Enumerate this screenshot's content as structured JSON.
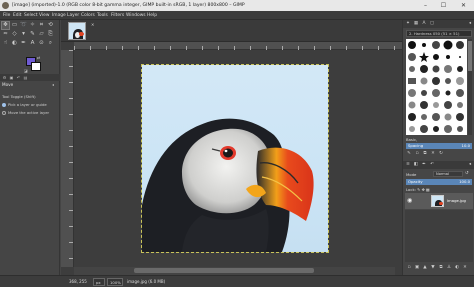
{
  "window": {
    "title": "[image] (imported)-1.0 (RGB color 8-bit gamma integer, GIMP built-in sRGB, 1 layer) 800x800 – GIMP",
    "minimize": "–",
    "maximize": "☐",
    "close": "✕"
  },
  "menu": [
    "File",
    "Edit",
    "Select",
    "View",
    "Image",
    "Layer",
    "Colors",
    "Tools",
    "Filters",
    "Windows",
    "Help"
  ],
  "colors": {
    "foreground": "#6f5bd4",
    "background": "#ffffff",
    "accent": "#5a86b8"
  },
  "tool_options": {
    "title": "Move",
    "tool_toggle_label": "Tool Toggle (Shift)",
    "option_pick": "Pick a layer or guide",
    "option_move_active": "Move the active layer"
  },
  "image_tab": {
    "close": "✕"
  },
  "brushes": {
    "filter_text": "2. Hardness 050 (51 × 51)",
    "tag": "Basic,",
    "spacing_label": "Spacing",
    "spacing_value": "10.0"
  },
  "layers": {
    "mode_label": "Mode",
    "mode_value": "Normal",
    "opacity_label": "Opacity",
    "opacity_value": "100.0",
    "lock_label": "Lock:",
    "items": [
      {
        "name": "image.jpg",
        "visible": true
      }
    ]
  },
  "status": {
    "coords": "368, 255",
    "unit": "px",
    "zoom": "100%",
    "message": "image.jpg (6.0 MB)"
  }
}
